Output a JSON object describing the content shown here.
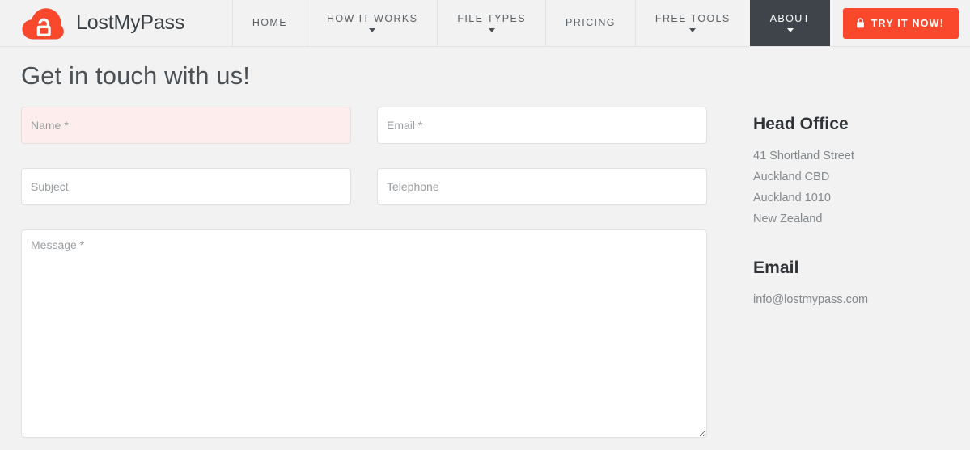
{
  "brand": {
    "name": "LostMyPass",
    "logo_icon": "cloud-lock-icon",
    "logo_color": "#f9482c"
  },
  "nav": {
    "items": [
      {
        "label": "HOME",
        "has_caret": false,
        "active": false
      },
      {
        "label": "HOW IT WORKS",
        "has_caret": true,
        "active": false
      },
      {
        "label": "FILE TYPES",
        "has_caret": true,
        "active": false
      },
      {
        "label": "PRICING",
        "has_caret": false,
        "active": false
      },
      {
        "label": "FREE TOOLS",
        "has_caret": true,
        "active": false
      },
      {
        "label": "ABOUT",
        "has_caret": true,
        "active": true
      }
    ],
    "cta": {
      "label": "TRY IT NOW!",
      "icon": "lock-icon",
      "background": "#f9482c",
      "text_color": "#ffffff"
    },
    "active_background": "#3e4449"
  },
  "page": {
    "title": "Get in touch with us!"
  },
  "form": {
    "name": {
      "placeholder": "Name *",
      "value": "",
      "state": "error",
      "error_background": "#fdeded"
    },
    "email": {
      "placeholder": "Email *",
      "value": ""
    },
    "subject": {
      "placeholder": "Subject",
      "value": ""
    },
    "telephone": {
      "placeholder": "Telephone",
      "value": ""
    },
    "message": {
      "placeholder": "Message *",
      "value": ""
    }
  },
  "info": {
    "office": {
      "heading": "Head Office",
      "lines": [
        "41 Shortland Street",
        "Auckland CBD",
        "Auckland 1010",
        "New Zealand"
      ]
    },
    "email": {
      "heading": "Email",
      "address": "info@lostmypass.com"
    }
  }
}
